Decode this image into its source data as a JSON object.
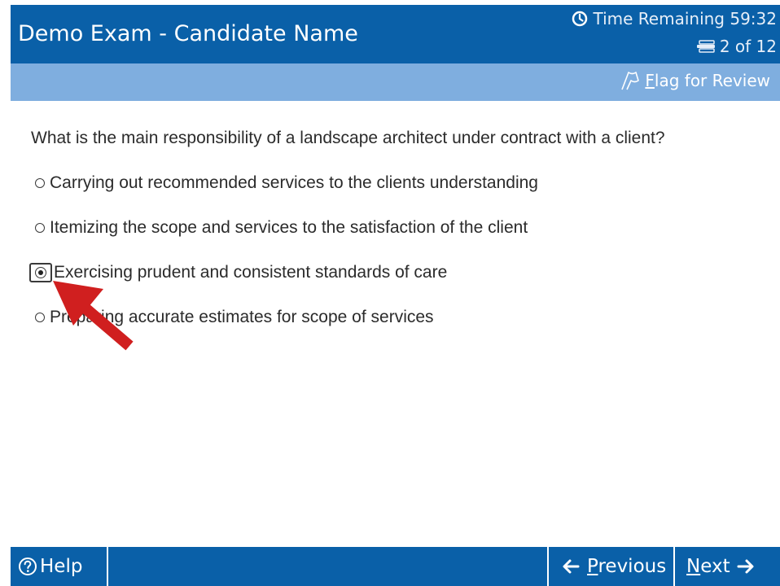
{
  "header": {
    "exam_title": "Demo Exam - Candidate Name",
    "time_remaining_label": "Time Remaining 59:32",
    "progress_label": "2 of 12",
    "clock_icon": "clock-icon",
    "question_list_icon": "question-list-icon"
  },
  "flag_bar": {
    "flag_label": "Flag for Review",
    "flag_icon": "flag-icon"
  },
  "question": {
    "text": "What is the main responsibility of a landscape architect under contract with a client?",
    "options": [
      {
        "label": "Carrying out recommended services to the clients understanding",
        "selected": false
      },
      {
        "label": "Itemizing the scope and services to the satisfaction of the client",
        "selected": false
      },
      {
        "label": "Exercising prudent and consistent standards of care",
        "selected": true
      },
      {
        "label": "Preparing accurate estimates for scope of services",
        "selected": false
      }
    ]
  },
  "footer": {
    "help_label": "Help",
    "previous_label": "Previous",
    "next_label": "Next",
    "help_icon": "question-circle-icon",
    "previous_icon": "arrow-left-icon",
    "next_icon": "arrow-right-icon"
  },
  "colors": {
    "header_blue": "#0a60a8",
    "flag_bar_blue": "#7faedf",
    "annotation_arrow": "#d01f1f"
  }
}
